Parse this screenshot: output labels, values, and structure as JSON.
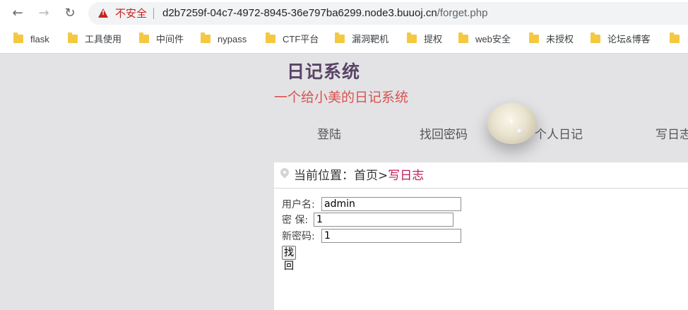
{
  "browser": {
    "back_icon": "arrow-left-icon",
    "forward_icon": "arrow-right-icon",
    "reload_icon": "reload-icon",
    "security_label": "不安全",
    "url_host": "d2b7259f-04c7-4972-8945-36e797ba6299.node3.buuoj.cn",
    "url_path": "/forget.php"
  },
  "bookmarks": [
    {
      "label": "flask"
    },
    {
      "label": "工具使用"
    },
    {
      "label": "中间件"
    },
    {
      "label": "nypass"
    },
    {
      "label": "CTF平台"
    },
    {
      "label": "漏洞靶机"
    },
    {
      "label": "提权"
    },
    {
      "label": "web安全"
    },
    {
      "label": "未授权"
    },
    {
      "label": "论坛&博客"
    }
  ],
  "site": {
    "title": "日记系统",
    "subtitle": "一个给小美的日记系统"
  },
  "nav": [
    "登陆",
    "找回密码",
    "个人日记",
    "写日志"
  ],
  "breadcrumb": {
    "prefix": "当前位置：",
    "home": "首页",
    "separator": ">",
    "current": "写日志"
  },
  "form": {
    "username_label": "用户名:",
    "username_value": "admin",
    "security_label": "密 保:",
    "security_value": "1",
    "newpass_label": "新密码:",
    "newpass_value": "1",
    "submit_label": "找回"
  }
}
